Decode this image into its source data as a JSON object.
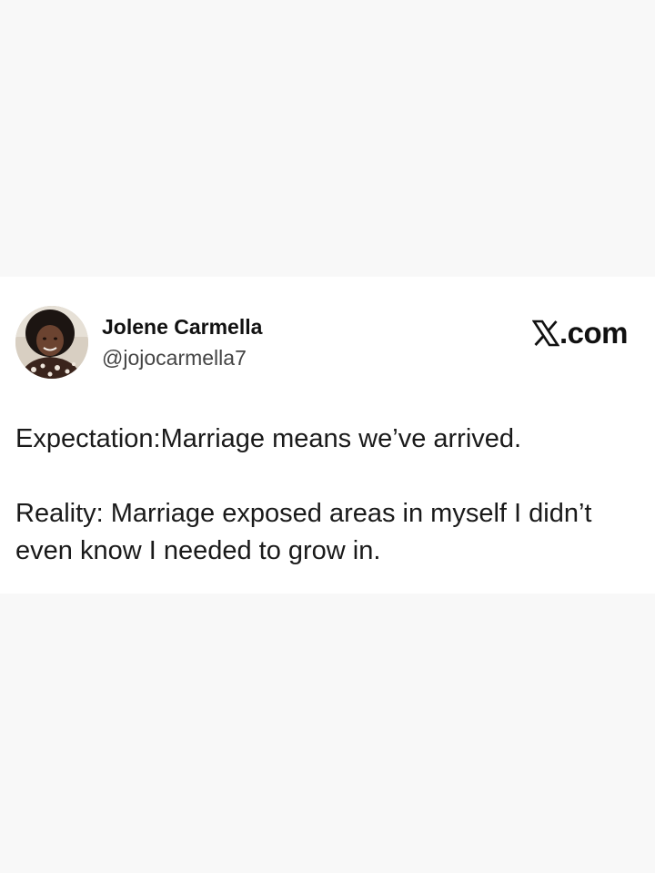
{
  "author": {
    "display_name": "Jolene Carmella",
    "handle": "@jojocarmella7"
  },
  "brand": {
    "label": ".com",
    "icon": "x-logo-icon"
  },
  "tweet": {
    "paragraph1": "Expectation:Marriage means we’ve arrived.",
    "paragraph2": "Reality: Marriage exposed areas in myself I didn’t even know I needed to grow in."
  },
  "colors": {
    "page_background": "#f8f8f8",
    "card_background": "#ffffff",
    "text_primary": "#1a1a1a",
    "text_secondary": "#444444"
  }
}
